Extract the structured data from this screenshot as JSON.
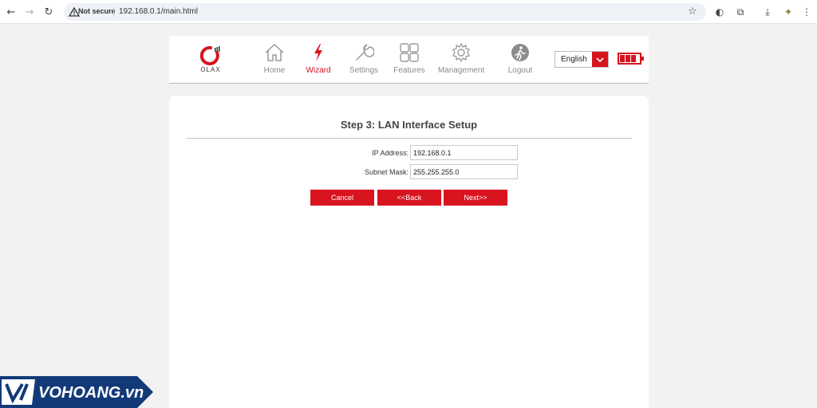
{
  "browser": {
    "security_label": "Not secure",
    "url": "192.168.0.1/main.html"
  },
  "header": {
    "logo_text": "OLAX",
    "nav": [
      {
        "label": "Home",
        "icon": "home-icon"
      },
      {
        "label": "Wizard",
        "icon": "wizard-icon",
        "active": true
      },
      {
        "label": "Settings",
        "icon": "settings-icon"
      },
      {
        "label": "Features",
        "icon": "features-icon"
      },
      {
        "label": "Management",
        "icon": "management-icon"
      },
      {
        "label": "Logout",
        "icon": "logout-icon"
      }
    ],
    "language": "English",
    "battery_level": 1.0
  },
  "wizard": {
    "title": "Step 3: LAN Interface Setup",
    "ip_label": "IP Address:",
    "ip_value": "192.168.0.1",
    "mask_label": "Subnet Mask:",
    "mask_value": "255.255.255.0",
    "cancel_label": "Cancel",
    "back_label": "<<Back",
    "next_label": "Next>>"
  },
  "watermark": {
    "text": "VOHOANG.vn"
  },
  "colors": {
    "accent": "#d8141f",
    "nav_inactive": "#8a8a8a"
  }
}
